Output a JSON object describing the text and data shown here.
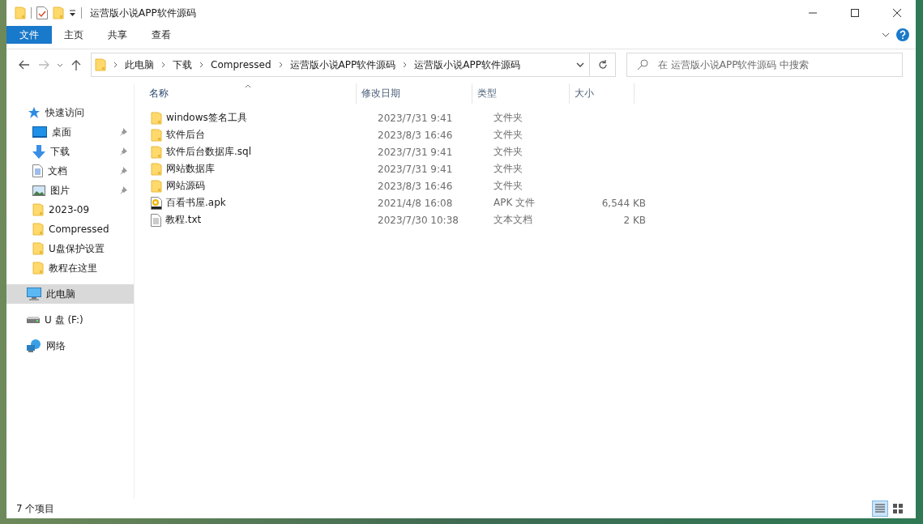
{
  "window": {
    "title": "运营版小说APP软件源码"
  },
  "ribbon_tabs": [
    {
      "label": "文件",
      "kind": "file"
    },
    {
      "label": "主页",
      "kind": "tab"
    },
    {
      "label": "共享",
      "kind": "tab"
    },
    {
      "label": "查看",
      "kind": "tab"
    }
  ],
  "address": {
    "crumbs": [
      "此电脑",
      "下载",
      "Compressed",
      "运营版小说APP软件源码",
      "运营版小说APP软件源码"
    ]
  },
  "search": {
    "placeholder": "在 运营版小说APP软件源码 中搜索"
  },
  "nav": [
    {
      "label": "快速访问",
      "kind": "quick",
      "pinned": false,
      "selected": false
    },
    {
      "label": "桌面",
      "kind": "desktop",
      "pinned": true,
      "selected": false
    },
    {
      "label": "下载",
      "kind": "download",
      "pinned": true,
      "selected": false
    },
    {
      "label": "文档",
      "kind": "document",
      "pinned": true,
      "selected": false
    },
    {
      "label": "图片",
      "kind": "pictures",
      "pinned": true,
      "selected": false
    },
    {
      "label": "2023-09",
      "kind": "folder",
      "pinned": false,
      "selected": false
    },
    {
      "label": "Compressed",
      "kind": "folder",
      "pinned": false,
      "selected": false
    },
    {
      "label": "U盘保护设置",
      "kind": "folder",
      "pinned": false,
      "selected": false
    },
    {
      "label": "教程在这里",
      "kind": "folder",
      "pinned": false,
      "selected": false
    },
    {
      "label": "此电脑",
      "kind": "pc",
      "pinned": false,
      "selected": true
    },
    {
      "label": "U 盘 (F:)",
      "kind": "drive",
      "pinned": false,
      "selected": false
    },
    {
      "label": "网络",
      "kind": "network",
      "pinned": false,
      "selected": false
    }
  ],
  "columns": [
    {
      "label": "名称",
      "sorted": true
    },
    {
      "label": "修改日期",
      "sorted": false
    },
    {
      "label": "类型",
      "sorted": false
    },
    {
      "label": "大小",
      "sorted": false
    }
  ],
  "files": [
    {
      "name": "windows签名工具",
      "date": "2023/7/31 9:41",
      "type": "文件夹",
      "kind": "folder"
    },
    {
      "name": "软件后台",
      "date": "2023/8/3 16:46",
      "type": "文件夹",
      "kind": "folder"
    },
    {
      "name": "软件后台数据库.sql",
      "date": "2023/7/31 9:41",
      "type": "文件夹",
      "kind": "folder"
    },
    {
      "name": "网站数据库",
      "date": "2023/7/31 9:41",
      "type": "文件夹",
      "kind": "folder"
    },
    {
      "name": "网站源码",
      "date": "2023/8/3 16:46",
      "type": "文件夹",
      "kind": "folder"
    },
    {
      "name": "百看书屋.apk",
      "date": "2021/4/8 16:08",
      "type": "APK 文件",
      "size": "6,544 KB",
      "kind": "apk"
    },
    {
      "name": "教程.txt",
      "date": "2023/7/30 10:38",
      "type": "文本文档",
      "size": "2 KB",
      "kind": "text"
    }
  ],
  "status": {
    "count": "7 个项目"
  },
  "view_buttons": [
    {
      "kind": "details",
      "selected": true
    },
    {
      "kind": "tiles",
      "selected": false
    }
  ]
}
